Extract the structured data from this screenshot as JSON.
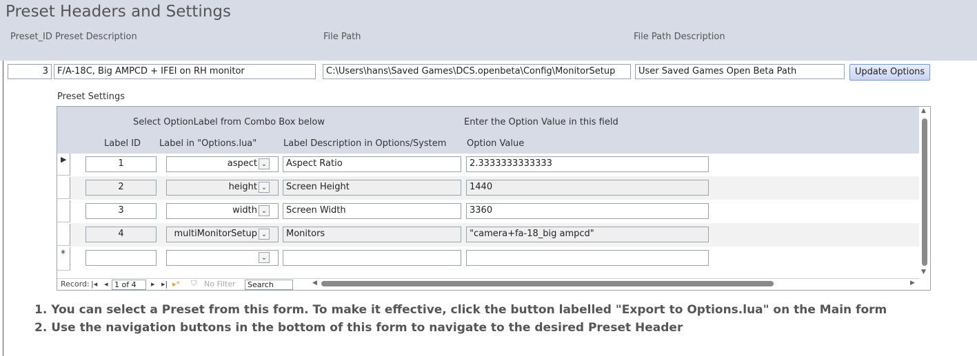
{
  "form": {
    "title": "Preset Headers and Settings",
    "col_headers": {
      "preset_id": "Preset_ID",
      "preset_description": "Preset Description",
      "file_path": "File Path",
      "file_path_description": "File Path Description"
    },
    "record": {
      "preset_id": "3",
      "preset_description": "F/A-18C, Big AMPCD + IFEI on RH monitor",
      "file_path": "C:\\Users\\hans\\Saved Games\\DCS.openbeta\\Config\\MonitorSetup",
      "file_path_description": "User Saved Games Open Beta Path"
    },
    "update_button": "Update Options"
  },
  "subform": {
    "caption": "Preset Settings",
    "hint_combo": "Select OptionLabel from Combo Box below",
    "hint_value": "Enter the Option Value in this field",
    "headers": {
      "label_id": "Label ID",
      "label_lua": "Label in \"Options.lua\"",
      "label_desc": "Label Description in Options/System",
      "option_value": "Option Value"
    },
    "rows": [
      {
        "id": "1",
        "label": "aspect",
        "desc": "Aspect Ratio",
        "value": "2.3333333333333"
      },
      {
        "id": "2",
        "label": "height",
        "desc": "Screen Height",
        "value": "1440"
      },
      {
        "id": "3",
        "label": "width",
        "desc": "Screen Width",
        "value": "3360"
      },
      {
        "id": "4",
        "label": "multiMonitorSetup",
        "desc": "Monitors",
        "value": "\"camera+fa-18_big ampcd\""
      }
    ],
    "new_row_marker": "*",
    "current_row_marker": "▶",
    "nav": {
      "record_label": "Record:",
      "first": "|◂",
      "prev": "◂",
      "position": "1 of 4",
      "next": "▸",
      "last": "▸|",
      "new": "▸*",
      "filter_icon": "funnel-icon",
      "filter": "No Filter",
      "search": "Search"
    }
  },
  "notes": [
    "1. You can select a Preset from this form. To make it effective, click the button labelled \"Export to Options.lua\" on the Main form",
    "2. Use the navigation buttons in the bottom of this form to navigate to the desired Preset Header"
  ]
}
